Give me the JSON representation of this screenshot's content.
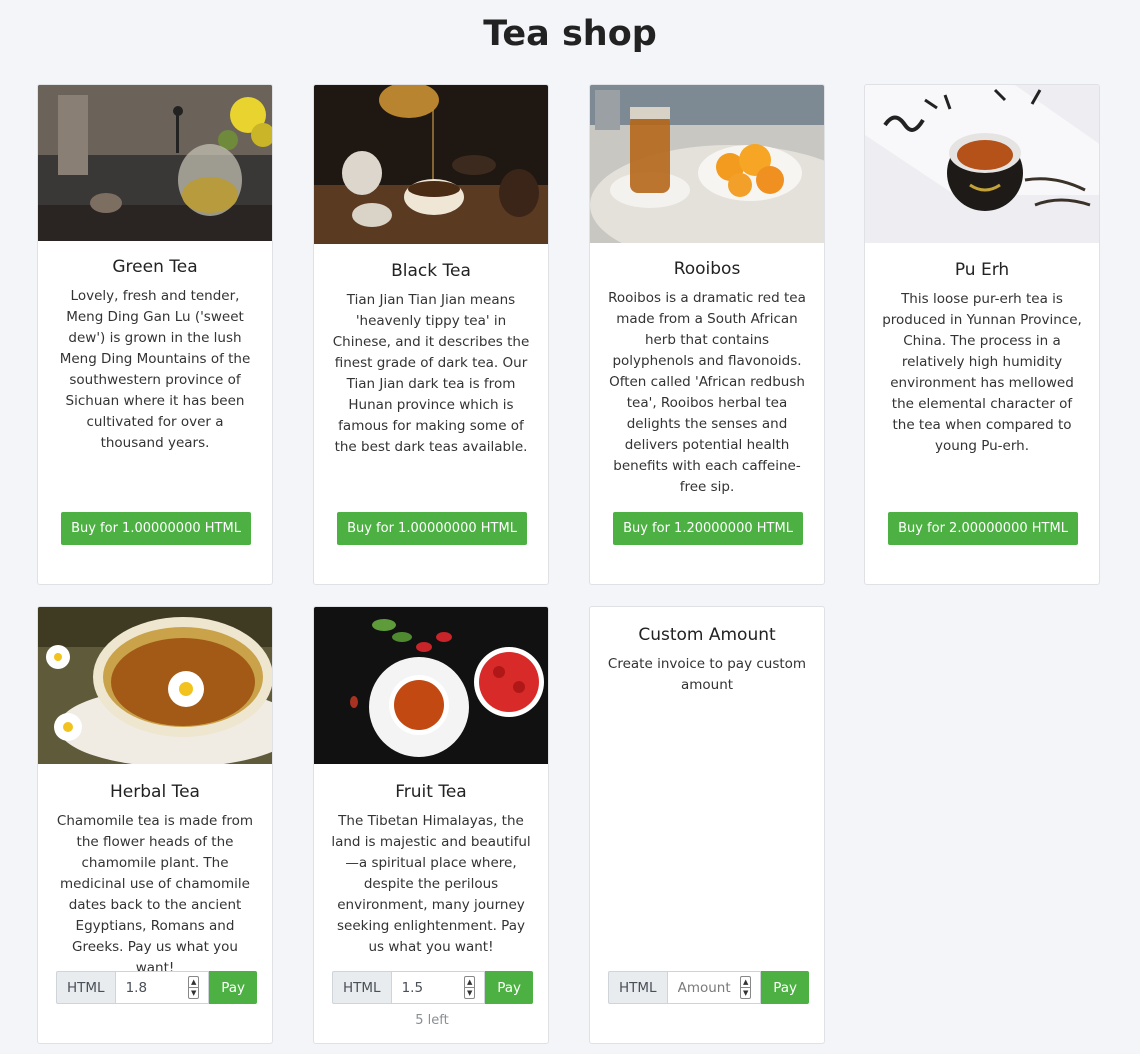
{
  "page": {
    "title": "Tea shop"
  },
  "products": [
    {
      "title": "Green Tea",
      "description": "Lovely, fresh and tender, Meng Ding Gan Lu ('sweet dew') is grown in the lush Meng Ding Mountains of the southwestern province of Sichuan where it has been cultivated for over a thousand years.",
      "buy_label": "Buy for 1.00000000 HTML"
    },
    {
      "title": "Black Tea",
      "description": "Tian Jian Tian Jian means 'heavenly tippy tea' in Chinese, and it describes the finest grade of dark tea. Our Tian Jian dark tea is from Hunan province which is famous for making some of the best dark teas available.",
      "buy_label": "Buy for 1.00000000 HTML"
    },
    {
      "title": "Rooibos",
      "description": "Rooibos is a dramatic red tea made from a South African herb that contains polyphenols and flavonoids. Often called 'African redbush tea', Rooibos herbal tea delights the senses and delivers potential health benefits with each caffeine-free sip.",
      "buy_label": "Buy for 1.20000000 HTML"
    },
    {
      "title": "Pu Erh",
      "description": "This loose pur-erh tea is produced in Yunnan Province, China. The process in a relatively high humidity environment has mellowed the elemental character of the tea when compared to young Pu-erh.",
      "buy_label": "Buy for 2.00000000 HTML"
    },
    {
      "title": "Herbal Tea",
      "description": "Chamomile tea is made from the flower heads of the chamomile plant. The medicinal use of chamomile dates back to the ancient Egyptians, Romans and Greeks. Pay us what you want!",
      "currency": "HTML",
      "amount": "1.8",
      "pay_label": "Pay"
    },
    {
      "title": "Fruit Tea",
      "description": "The Tibetan Himalayas, the land is majestic and beautiful—a spiritual place where, despite the perilous environment, many journey seeking enlightenment. Pay us what you want!",
      "currency": "HTML",
      "amount": "1.5",
      "pay_label": "Pay",
      "stock": "5 left"
    },
    {
      "title": "Custom Amount",
      "description": "Create invoice to pay custom amount",
      "currency": "HTML",
      "amount_placeholder": "Amount",
      "pay_label": "Pay"
    }
  ],
  "colors": {
    "accent": "#4cb142",
    "background": "#f4f5f8"
  }
}
